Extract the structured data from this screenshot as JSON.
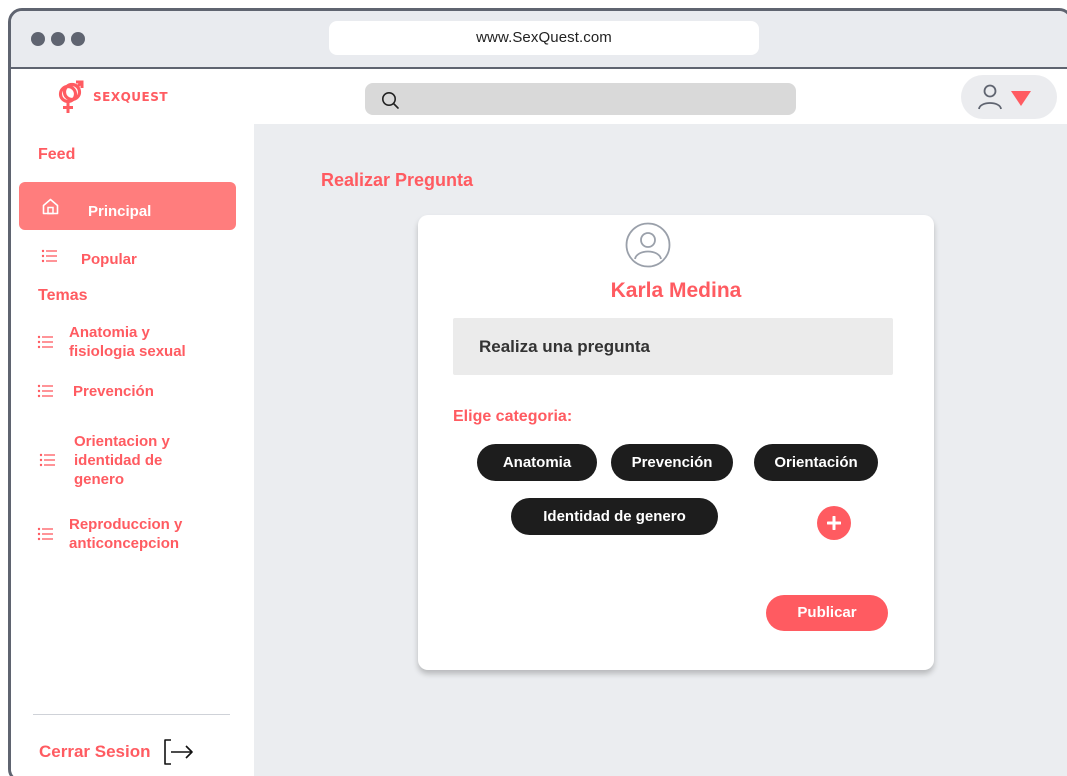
{
  "browser": {
    "url": "www.SexQuest.com"
  },
  "header": {
    "logo_text": "SEXQUEST",
    "search_placeholder": ""
  },
  "sidebar": {
    "feed_title": "Feed",
    "feed_items": [
      {
        "label": "Principal",
        "icon": "home-icon",
        "active": true
      },
      {
        "label": "Popular",
        "icon": "list-icon",
        "active": false
      }
    ],
    "topics_title": "Temas",
    "topic_items": [
      {
        "label": "Anatomia y fisiologia sexual",
        "icon": "list-icon"
      },
      {
        "label": "Prevención",
        "icon": "list-icon"
      },
      {
        "label": "Orientacion y identidad de genero",
        "icon": "list-icon"
      },
      {
        "label": "Reproduccion y anticoncepcion",
        "icon": "list-icon"
      }
    ],
    "logout_label": "Cerrar Sesion"
  },
  "main": {
    "title": "Realizar Pregunta",
    "card": {
      "user_name": "Karla Medina",
      "question_placeholder": "Realiza una pregunta",
      "category_label": "Elige categoria:",
      "categories": [
        "Anatomia",
        "Prevención",
        "Orientación",
        "Identidad de genero"
      ],
      "publish_label": "Publicar"
    }
  },
  "colors": {
    "accent": "#ff5b61",
    "active_nav": "#ff7d7d",
    "chip": "#1d1d1d",
    "frame": "#5f6470",
    "main_background": "#ebedf0"
  }
}
